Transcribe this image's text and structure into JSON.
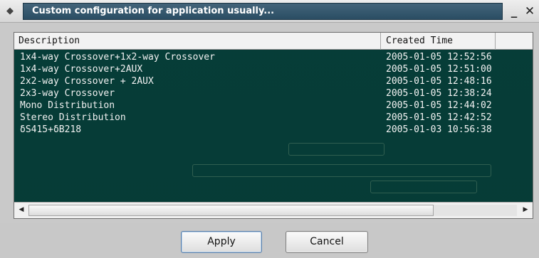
{
  "window": {
    "title": "Custom configuration for application  usually...",
    "minimize_label": "_",
    "close_label": "✕"
  },
  "table": {
    "columns": [
      "Description",
      "Created Time"
    ],
    "rows": [
      {
        "description": "1x4-way Crossover+1x2-way Crossover",
        "created": "2005-01-05 12:52:56"
      },
      {
        "description": "1x4-way Crossover+2AUX",
        "created": "2005-01-05 12:51:00"
      },
      {
        "description": "2x2-way Crossover + 2AUX",
        "created": "2005-01-05 12:48:16"
      },
      {
        "description": "2x3-way Crossover",
        "created": "2005-01-05 12:38:24"
      },
      {
        "description": "Mono Distribution",
        "created": "2005-01-05 12:44:02"
      },
      {
        "description": "Stereo Distribution",
        "created": "2005-01-05 12:42:52"
      },
      {
        "description": "δS415+δB218",
        "created": "2005-01-03 10:56:38"
      }
    ]
  },
  "scrollbar": {
    "left_arrow": "◀",
    "right_arrow": "▶",
    "thumb_fraction": 0.83
  },
  "buttons": {
    "apply": "Apply",
    "cancel": "Cancel"
  },
  "icons": {
    "app": "app-menu-icon",
    "left": "arrow-left-icon",
    "right": "arrow-right-icon"
  }
}
